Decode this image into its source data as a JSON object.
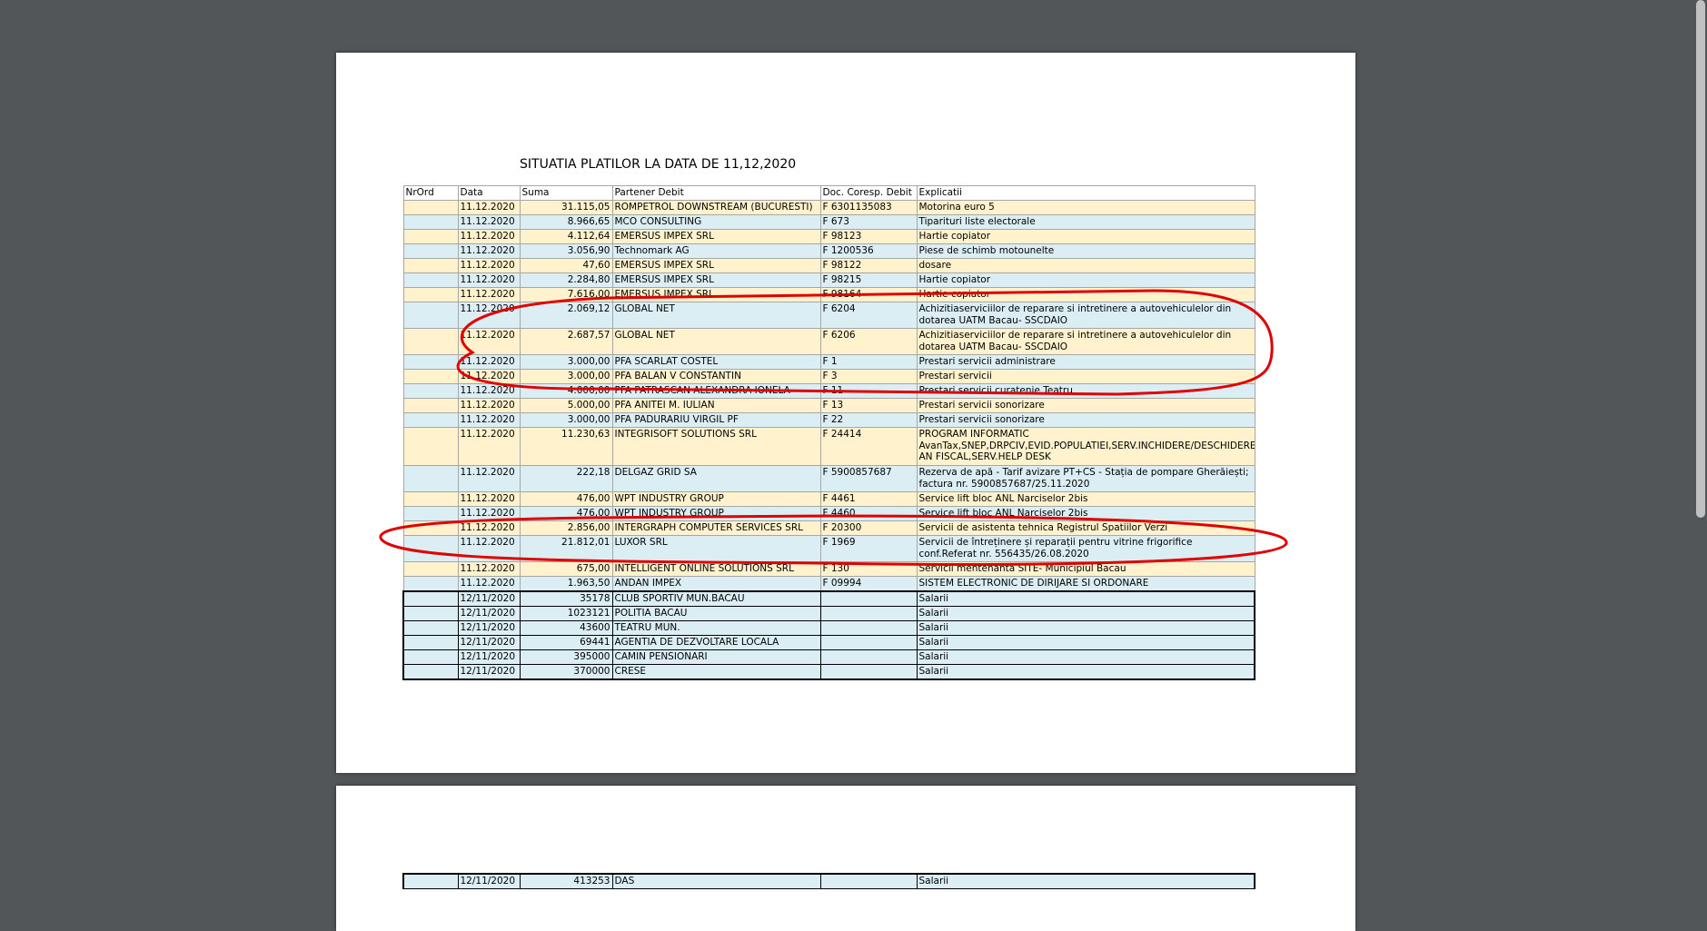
{
  "document": {
    "title": "SITUATIA PLATILOR LA DATA DE 11,12,2020",
    "headers": [
      "NrOrd",
      "Data",
      "Suma",
      "Partener Debit",
      "Doc. Coresp. Debit",
      "Explicatii"
    ]
  },
  "rows": [
    {
      "nr": "",
      "data": "11.12.2020",
      "suma": "31.115,05",
      "partener": "ROMPETROL DOWNSTREAM (BUCURESTI)",
      "doc": "F 6301135083",
      "explicatii": "Motorina euro 5"
    },
    {
      "nr": "",
      "data": "11.12.2020",
      "suma": "8.966,65",
      "partener": "MCO CONSULTING",
      "doc": "F 673",
      "explicatii": "Tiparituri liste electorale"
    },
    {
      "nr": "",
      "data": "11.12.2020",
      "suma": "4.112,64",
      "partener": "EMERSUS IMPEX SRL",
      "doc": "F 98123",
      "explicatii": "Hartie copiator"
    },
    {
      "nr": "",
      "data": "11.12.2020",
      "suma": "3.056,90",
      "partener": "Technomark AG",
      "doc": "F 1200536",
      "explicatii": "Piese de schimb motounelte"
    },
    {
      "nr": "",
      "data": "11.12.2020",
      "suma": "47,60",
      "partener": "EMERSUS IMPEX SRL",
      "doc": "F 98122",
      "explicatii": "dosare"
    },
    {
      "nr": "",
      "data": "11.12.2020",
      "suma": "2.284,80",
      "partener": "EMERSUS IMPEX SRL",
      "doc": "F 98215",
      "explicatii": "Hartie copiator"
    },
    {
      "nr": "",
      "data": "11.12.2020",
      "suma": "7.616,00",
      "partener": "EMERSUS IMPEX SRL",
      "doc": "F 98164",
      "explicatii": "Hartie copiator"
    },
    {
      "nr": "",
      "data": "11.12.2020",
      "suma": "2.069,12",
      "partener": "GLOBAL NET",
      "doc": "F 6204",
      "explicatii": "Achizitiaserviciilor de reparare si intretinere a autovehiculelor  din dotarea UATM Bacau- SSCDAIO"
    },
    {
      "nr": "",
      "data": "11.12.2020",
      "suma": "2.687,57",
      "partener": "GLOBAL NET",
      "doc": "F 6206",
      "explicatii": "Achizitiaserviciilor de reparare si intretinere a autovehiculelor  din dotarea UATM Bacau- SSCDAIO"
    },
    {
      "nr": "",
      "data": "11.12.2020",
      "suma": "3.000,00",
      "partener": "PFA SCARLAT COSTEL",
      "doc": "F 1",
      "explicatii": "Prestari servicii administrare"
    },
    {
      "nr": "",
      "data": "11.12.2020",
      "suma": "3.000,00",
      "partener": "PFA BALAN V CONSTANTIN",
      "doc": "F 3",
      "explicatii": "Prestari servicii"
    },
    {
      "nr": "",
      "data": "11.12.2020",
      "suma": "4.000,00",
      "partener": "PFA PATRASCAN ALEXANDRA IONELA",
      "doc": "F 11",
      "explicatii": "Prestari servicii curatenie Teatru"
    },
    {
      "nr": "",
      "data": "11.12.2020",
      "suma": "5.000,00",
      "partener": "PFA ANITEI M. IULIAN",
      "doc": "F 13",
      "explicatii": "Prestari servicii sonorizare"
    },
    {
      "nr": "",
      "data": "11.12.2020",
      "suma": "3.000,00",
      "partener": "PFA PADURARIU VIRGIL PF",
      "doc": "F 22",
      "explicatii": "Prestari servicii sonorizare"
    },
    {
      "nr": "",
      "data": "11.12.2020",
      "suma": "11.230,63",
      "partener": "INTEGRISOFT SOLUTIONS SRL",
      "doc": "F 24414",
      "explicatii": "PROGRAM INFORMATIC AvanTax,SNEP,DRPCIV,EVID.POPULATIEI,SERV.INCHIDERE/DESCHIDERE AN FISCAL,SERV.HELP DESK"
    },
    {
      "nr": "",
      "data": "11.12.2020",
      "suma": "222,18",
      "partener": "DELGAZ GRID SA",
      "doc": "F 5900857687",
      "explicatii": "Rezerva de apă - Tarif avizare PT+CS - Stația de pompare Gherăiești; factura nr. 5900857687/25.11.2020"
    },
    {
      "nr": "",
      "data": "11.12.2020",
      "suma": "476,00",
      "partener": "WPT INDUSTRY GROUP",
      "doc": "F 4461",
      "explicatii": "Service lift bloc ANL  Narciselor 2bis"
    },
    {
      "nr": "",
      "data": "11.12.2020",
      "suma": "476,00",
      "partener": "WPT INDUSTRY GROUP",
      "doc": "F 4460",
      "explicatii": "Service lift bloc ANL  Narciselor 2bis"
    },
    {
      "nr": "",
      "data": "11.12.2020",
      "suma": "2.856,00",
      "partener": "INTERGRAPH COMPUTER SERVICES SRL",
      "doc": "F 20300",
      "explicatii": "Servicii de asistenta tehnica Registrul Spatiilor Verzi"
    },
    {
      "nr": "",
      "data": "11.12.2020",
      "suma": "21.812,01",
      "partener": "LUXOR SRL",
      "doc": "F 1969",
      "explicatii": "Servicii de întreținere și reparații pentru vitrine frigorifice  conf.Referat nr. 556435/26.08.2020"
    },
    {
      "nr": "",
      "data": "11.12.2020",
      "suma": "675,00",
      "partener": "INTELLIGENT ONLINE SOLUTIONS SRL",
      "doc": "F 130",
      "explicatii": "Servicii mentenanta SITE- Municipiul Bacau"
    },
    {
      "nr": "",
      "data": "11.12.2020",
      "suma": "1.963,50",
      "partener": "ANDAN IMPEX",
      "doc": "F 09994",
      "explicatii": "SISTEM ELECTRONIC DE DIRIJARE SI ORDONARE"
    },
    {
      "nr": "",
      "data": "12/11/2020",
      "suma": "35178",
      "partener": "CLUB SPORTIV MUN.BACAU",
      "doc": "",
      "explicatii": "Salarii"
    },
    {
      "nr": "",
      "data": "12/11/2020",
      "suma": "1023121",
      "partener": "POLITIA BACAU",
      "doc": "",
      "explicatii": "Salarii"
    },
    {
      "nr": "",
      "data": "12/11/2020",
      "suma": "43600",
      "partener": "TEATRU MUN.",
      "doc": "",
      "explicatii": "Salarii"
    },
    {
      "nr": "",
      "data": "12/11/2020",
      "suma": "69441",
      "partener": "AGENTIA DE DEZVOLTARE LOCALA",
      "doc": "",
      "explicatii": "Salarii"
    },
    {
      "nr": "",
      "data": "12/11/2020",
      "suma": "395000",
      "partener": "CAMIN PENSIONARI",
      "doc": "",
      "explicatii": "Salarii"
    },
    {
      "nr": "",
      "data": "12/11/2020",
      "suma": "370000",
      "partener": "CRESE",
      "doc": "",
      "explicatii": "Salarii"
    }
  ],
  "page2_rows": [
    {
      "nr": "",
      "data": "12/11/2020",
      "suma": "413253",
      "partener": "DAS",
      "doc": "",
      "explicatii": "Salarii"
    }
  ],
  "colors": {
    "viewer_bg": "#525659",
    "row_yellow": "#fff2cc",
    "row_blue": "#dbeef3",
    "annotation_red": "#e00000"
  }
}
